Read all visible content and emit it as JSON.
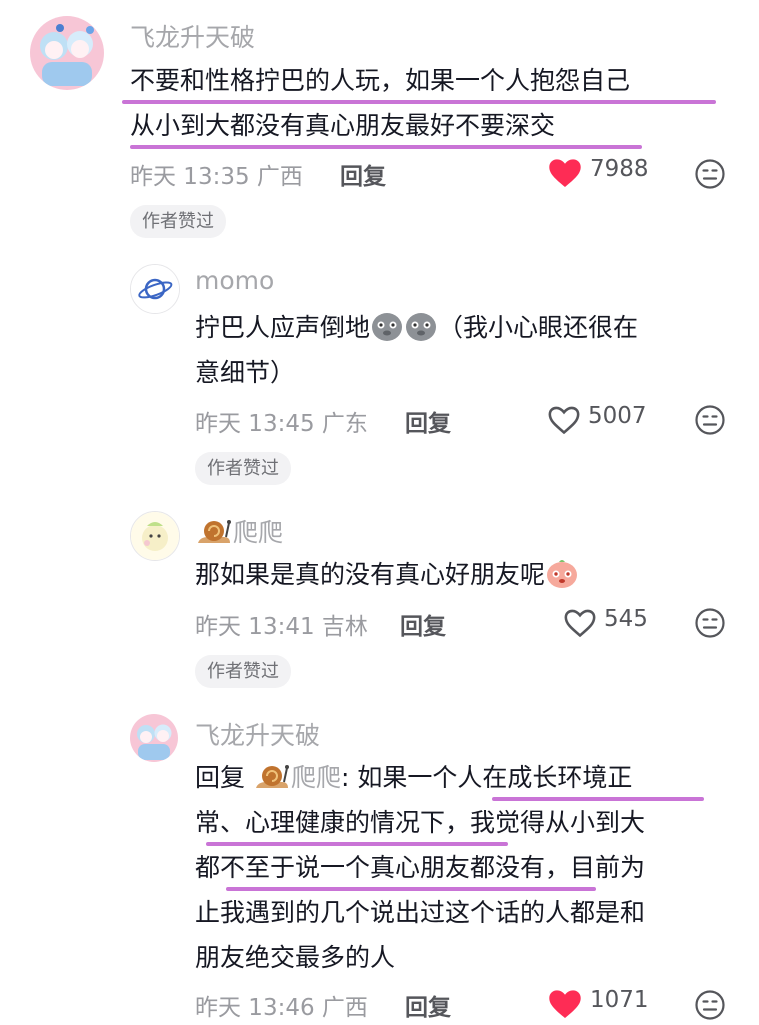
{
  "comments": [
    {
      "author": "飞龙升天破",
      "lines": [
        "不要和性格拧巴的人玩，如果一个人抱怨自己",
        "从小到大都没有真心朋友最好不要深交"
      ],
      "time": "昨天 13:35 广西",
      "reply_label": "回复",
      "likes": "7988",
      "liked": true,
      "badge": "作者赞过"
    },
    {
      "author": "momo",
      "lines": [
        "拧巴人应声倒地",
        "（我小心眼还很在",
        "意细节）"
      ],
      "time": "昨天 13:45 广东",
      "reply_label": "回复",
      "likes": "5007",
      "liked": false,
      "badge": "作者赞过"
    },
    {
      "author": "爬爬",
      "lines": [
        "那如果是真的没有真心好朋友呢"
      ],
      "time": "昨天 13:41 吉林",
      "reply_label": "回复",
      "likes": "545",
      "liked": false,
      "badge": "作者赞过"
    },
    {
      "author": "飞龙升天破",
      "reply_prefix": "回复",
      "reply_to": "爬爬",
      "lines": [
        ": 如果一个人在成长环境正",
        "常、心理健康的情况下，我觉得从小到大",
        "都不至于说一个真心朋友都没有，目前为",
        "止我遇到的几个说出过这个话的人都是和",
        "朋友绝交最多的人"
      ],
      "time": "昨天 13:46 广西",
      "reply_label": "回复",
      "likes": "1071",
      "liked": true
    }
  ],
  "colors": {
    "heart": "#fe2c55",
    "underline": "#c974d6"
  },
  "icons": [
    "heart-filled-icon",
    "heart-outline-icon",
    "dislike-face-icon",
    "snail-emoji",
    "sweat-face-emoji",
    "blush-face-emoji"
  ]
}
